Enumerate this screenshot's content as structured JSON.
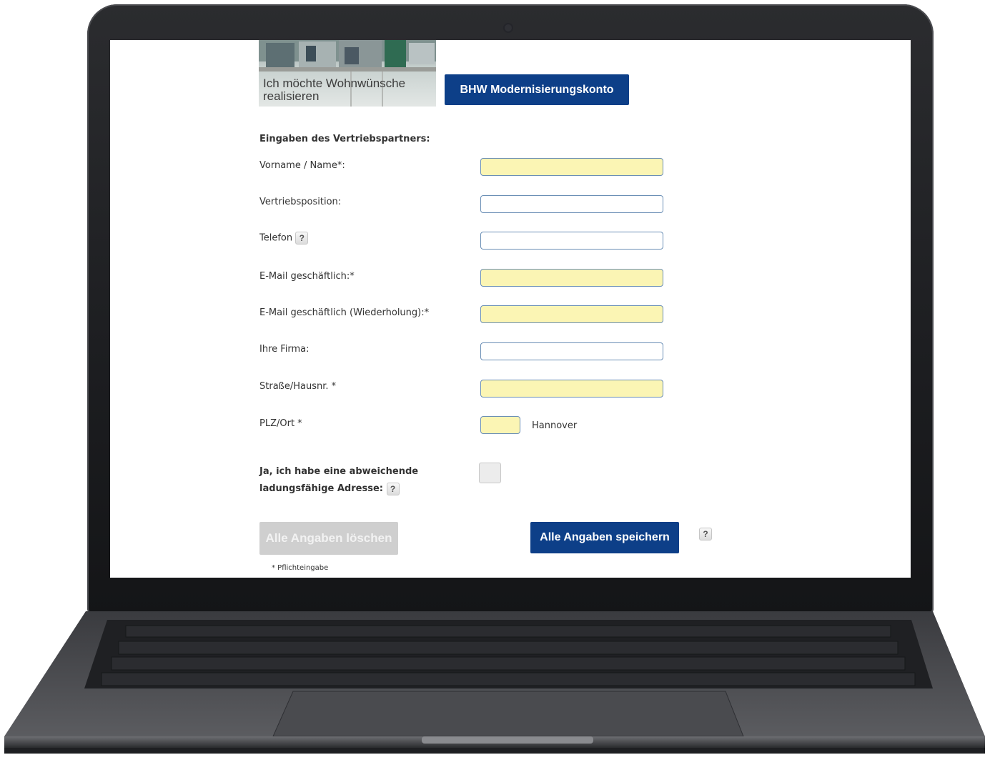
{
  "hero": {
    "caption": "Ich möchte Wohnwünsche realisieren"
  },
  "product_button": "BHW Modernisierungskonto",
  "form": {
    "section_title": "Eingaben des Vertriebspartners:",
    "fields": {
      "name": {
        "label": "Vorname / Name*:",
        "value": "",
        "required": true
      },
      "position": {
        "label": "Vertriebsposition:",
        "value": "",
        "required": false
      },
      "phone": {
        "label": "Telefon",
        "value": "",
        "required": false,
        "help": "?"
      },
      "email": {
        "label": "E-Mail geschäftlich:*",
        "value": "",
        "required": true
      },
      "email_repeat": {
        "label": "E-Mail geschäftlich (Wiederholung):*",
        "value": "",
        "required": true
      },
      "company": {
        "label": "Ihre Firma:",
        "value": "",
        "required": false
      },
      "street": {
        "label": "Straße/Hausnr. *",
        "value": "",
        "required": true
      },
      "zip": {
        "label": "PLZ/Ort *",
        "value": "",
        "required": true
      },
      "city": "Hannover"
    },
    "alt_address": {
      "label_line1": "Ja, ich habe eine abweichende",
      "label_line2": "ladungsfähige Adresse:",
      "help": "?",
      "checked": false
    },
    "clear_button": "Alle Angaben löschen",
    "save_button": "Alle Angaben speichern",
    "save_help": "?",
    "footnote": "* Pflichteingabe"
  },
  "colors": {
    "brand_blue": "#0d3f88",
    "required_field": "#fbf5b4",
    "disabled_button": "#cfcfcf",
    "laptop_body": "#1c1d20"
  }
}
